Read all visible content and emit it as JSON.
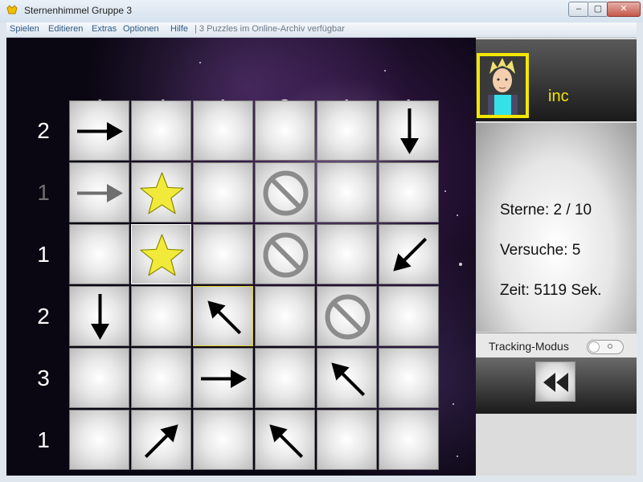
{
  "window": {
    "title": "Sternenhimmel Gruppe 3"
  },
  "menu": {
    "items": [
      "Spielen",
      "Editieren",
      "Extras",
      "Optionen",
      "Hilfe"
    ],
    "status": "| 3 Puzzles im Online-Archiv verfügbar"
  },
  "clues": {
    "columns": [
      "1",
      "4",
      "1",
      "2",
      "1",
      "1"
    ],
    "rows": [
      "2",
      "1",
      "1",
      "2",
      "3",
      "1"
    ],
    "row_dimmed": [
      false,
      true,
      false,
      false,
      false,
      false
    ]
  },
  "grid": [
    [
      "arrow-e",
      "",
      "",
      "",
      "",
      "arrow-s"
    ],
    [
      "arrow-e-gray",
      "star",
      "",
      "blocked",
      "",
      ""
    ],
    [
      "",
      "star",
      "",
      "blocked",
      "",
      "arrow-sw"
    ],
    [
      "arrow-s",
      "",
      "arrow-nw",
      "",
      "blocked",
      ""
    ],
    [
      "",
      "",
      "arrow-e",
      "",
      "arrow-nw",
      ""
    ],
    [
      "",
      "arrow-ne",
      "",
      "arrow-nw",
      "",
      ""
    ]
  ],
  "highlighted": {
    "gray": [
      2,
      1
    ],
    "yellow": [
      3,
      2
    ]
  },
  "player": {
    "name": "inc"
  },
  "stats": {
    "stars": "Sterne: 2 / 10",
    "attempts": "Versuche: 5",
    "time": "Zeit: 5119 Sek."
  },
  "tracking": {
    "label": "Tracking-Modus",
    "enabled": false
  },
  "colors": {
    "accent": "#f3e600",
    "star_fill": "#f2ea3a",
    "star_stroke": "#8a8a00"
  }
}
